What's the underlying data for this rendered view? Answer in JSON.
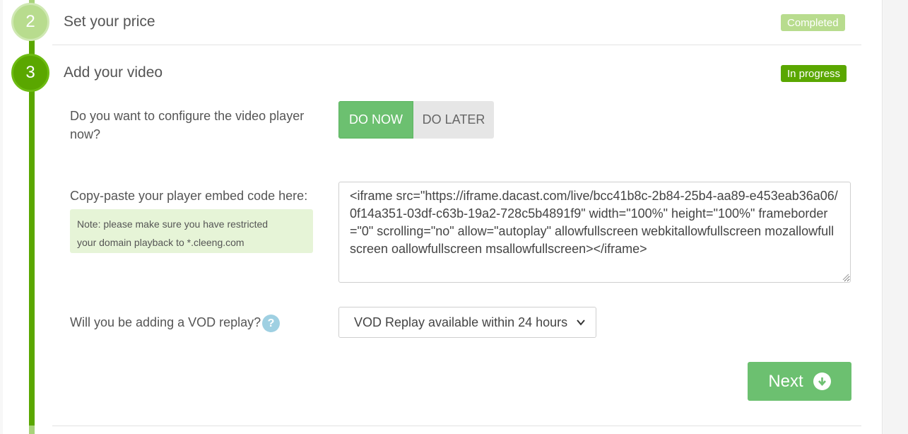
{
  "steps": [
    {
      "number": "2",
      "title": "Set your price",
      "status": "Completed"
    },
    {
      "number": "3",
      "title": "Add your video",
      "status": "In progress"
    }
  ],
  "configure": {
    "question_line1": "Do you want to configure the video player",
    "question_line2": "now?",
    "do_now": "DO NOW",
    "do_later": "DO LATER"
  },
  "embed": {
    "label": "Copy-paste your player embed code here:",
    "note_line1": "Note: please make sure you have restricted",
    "note_line2": "your domain playback to *.cleeng.com",
    "code": "<iframe src=\"https://iframe.dacast.com/live/bcc41b8c-2b84-25b4-aa89-e453eab36a06/0f14a351-03df-c63b-19a2-728c5b4891f9\" width=\"100%\" height=\"100%\" frameborder=\"0\" scrolling=\"no\" allow=\"autoplay\" allowfullscreen webkitallowfullscreen mozallowfullscreen oallowfullscreen msallowfullscreen></iframe>"
  },
  "vod": {
    "label": "Will you be adding a VOD replay?",
    "help": "?",
    "selected": "VOD Replay available within 24 hours"
  },
  "next_label": "Next",
  "colors": {
    "accent": "#5aa700",
    "light_accent": "#b8dc8e",
    "button_green": "#6cc070",
    "help_blue": "#9fd0e2"
  }
}
